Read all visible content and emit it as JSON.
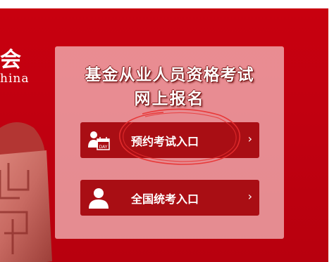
{
  "brand": {
    "cn_fragment": "会",
    "en_fragment": "hina"
  },
  "panel": {
    "title_line1": "基金从业人员资格考试",
    "title_line2": "网上报名"
  },
  "buttons": [
    {
      "label": "预约考试入口",
      "icon": "calendar-person-icon",
      "arrow": "›"
    },
    {
      "label": "全国统考入口",
      "icon": "person-icon",
      "arrow": "›"
    }
  ],
  "calendar_icon_text": "DAY",
  "colors": {
    "banner": "#c00010",
    "button": "#a90e14",
    "annotation": "#e83030"
  }
}
